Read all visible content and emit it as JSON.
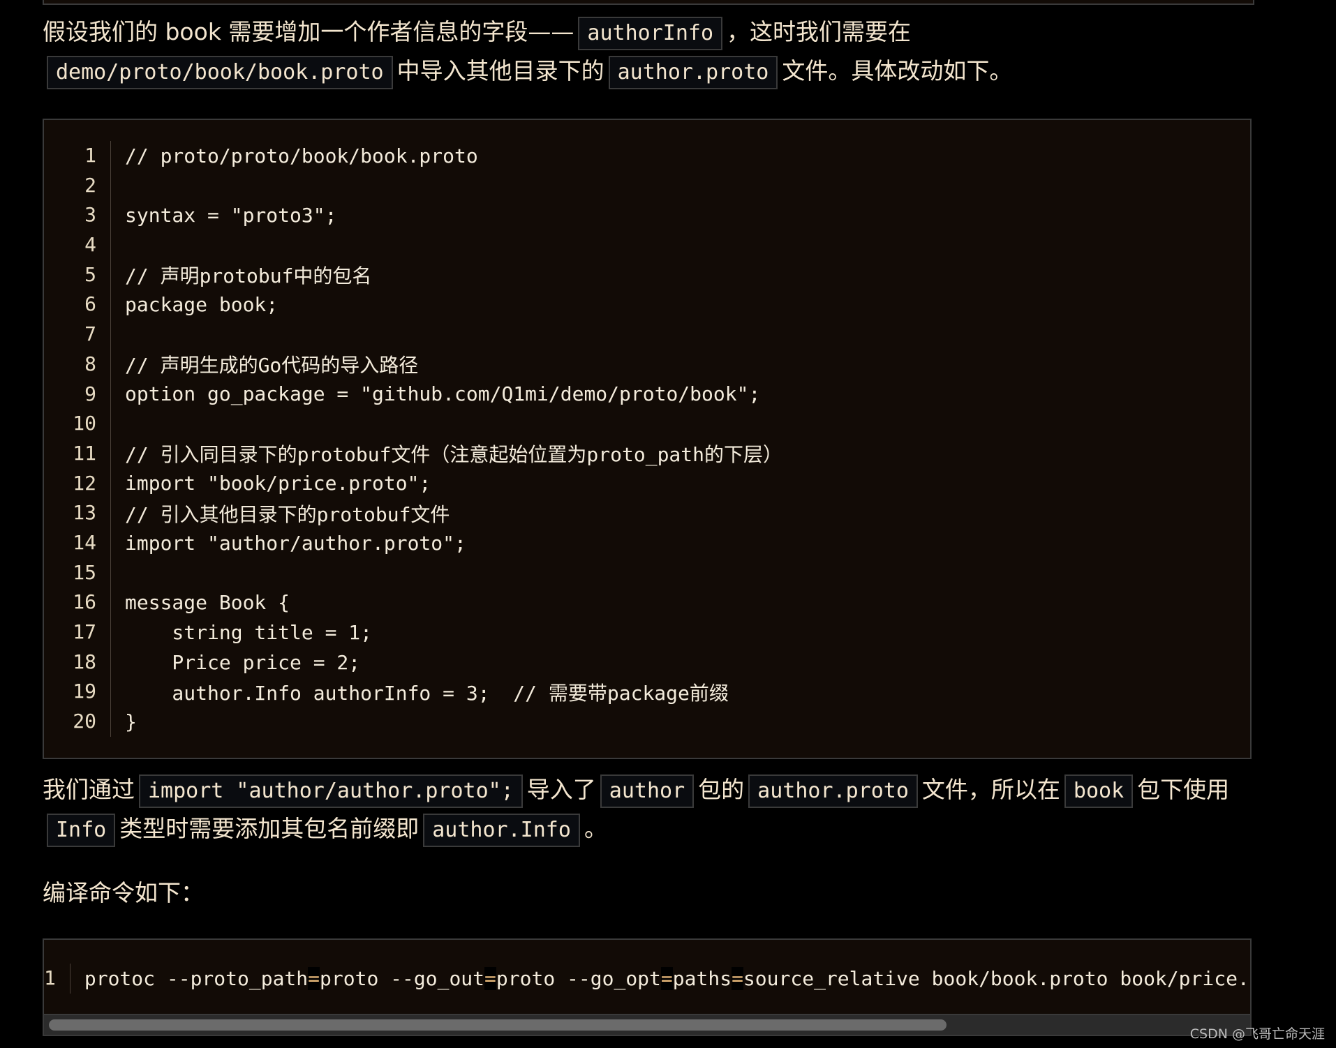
{
  "para1": {
    "t1": "假设我们的 book 需要增加一个作者信息的字段——",
    "c1": "authorInfo",
    "t2": "，这时我们需要在",
    "c2": "demo/proto/book/book.proto",
    "t3": "中导入其他目录下的",
    "c3": "author.proto",
    "t4": "文件。具体改动如下。"
  },
  "code1": {
    "lines": [
      "// proto/proto/book/book.proto",
      "",
      "syntax = \"proto3\";",
      "",
      "// 声明protobuf中的包名",
      "package book;",
      "",
      "// 声明生成的Go代码的导入路径",
      "option go_package = \"github.com/Q1mi/demo/proto/book\";",
      "",
      "// 引入同目录下的protobuf文件（注意起始位置为proto_path的下层）",
      "import \"book/price.proto\";",
      "// 引入其他目录下的protobuf文件",
      "import \"author/author.proto\";",
      "",
      "message Book {",
      "    string title = 1;",
      "    Price price = 2;",
      "    author.Info authorInfo = 3;  // 需要带package前缀",
      "}"
    ]
  },
  "para2": {
    "t1": "我们通过",
    "c1": "import \"author/author.proto\";",
    "t2": "导入了",
    "c2": "author",
    "t3": "包的",
    "c3": "author.proto",
    "t4": "文件，所以在",
    "c4": "book",
    "t5": "包下使用",
    "c5": "Info",
    "t6": "类型时需要添加其包名前缀即",
    "c6": "author.Info",
    "t7": "。"
  },
  "para3": "编译命令如下：",
  "code2": {
    "line_number": "1",
    "parts": [
      "protoc --proto_path",
      "=",
      "proto --go_out",
      "=",
      "proto --go_opt",
      "=",
      "paths",
      "=",
      "source_relative book/book.proto book/price.proto author/author.proto"
    ]
  },
  "scrollbar": {
    "thumb_fraction": 0.75
  },
  "watermark": "CSDN @飞哥亡命天涯"
}
